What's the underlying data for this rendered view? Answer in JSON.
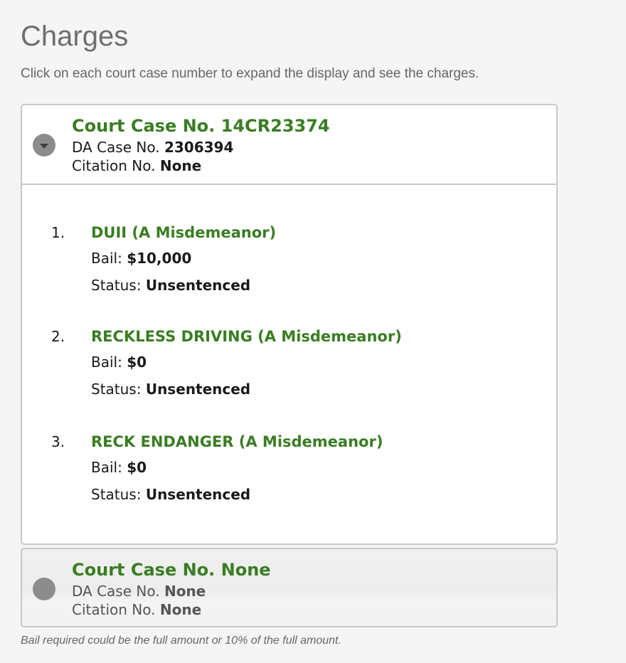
{
  "page": {
    "title": "Charges",
    "intro": "Click on each court case number to expand the display and see the charges."
  },
  "cases": [
    {
      "court_case_label": "Court Case No. 14CR23374",
      "da_label": "DA Case No.",
      "da_value": "2306394",
      "citation_label": "Citation No.",
      "citation_value": "None",
      "expanded": true,
      "charges": [
        {
          "number": "1.",
          "name": "DUII (A Misdemeanor)",
          "bail_label": "Bail:",
          "bail": "$10,000",
          "status_label": "Status:",
          "status": "Unsentenced"
        },
        {
          "number": "2.",
          "name": "RECKLESS DRIVING (A Misdemeanor)",
          "bail_label": "Bail:",
          "bail": "$0",
          "status_label": "Status:",
          "status": "Unsentenced"
        },
        {
          "number": "3.",
          "name": "RECK ENDANGER (A Misdemeanor)",
          "bail_label": "Bail:",
          "bail": "$0",
          "status_label": "Status:",
          "status": "Unsentenced"
        }
      ]
    },
    {
      "court_case_label": "Court Case No. None",
      "da_label": "DA Case No.",
      "da_value": "None",
      "citation_label": "Citation No.",
      "citation_value": "None",
      "expanded": false,
      "charges": []
    }
  ],
  "footnote": "Bail required could be the full amount or 10% of the full amount.",
  "colors": {
    "accent_green": "#3a7d23",
    "title_gray": "#6e6e6e",
    "border": "#c8c8c8"
  },
  "icons": {
    "expanded_toggle": "chevron-down-circle-icon",
    "collapsed_toggle": "circle-icon"
  }
}
